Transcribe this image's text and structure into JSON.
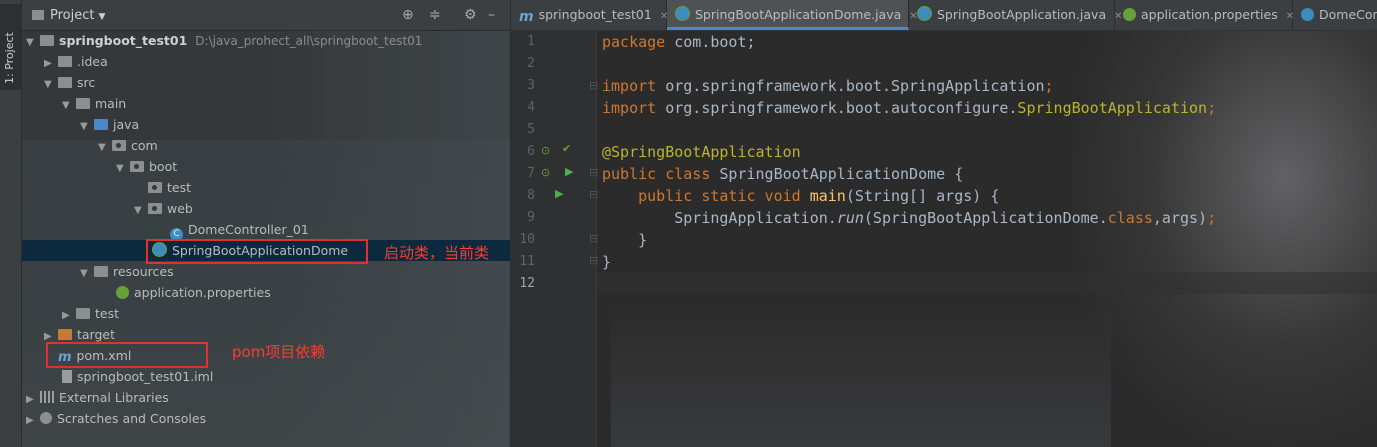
{
  "tool_strip": {
    "project_tab": "1: Project"
  },
  "project_panel": {
    "title": "Project",
    "tree": [
      {
        "label": "springboot_test01",
        "path": "D:\\java_prohect_all\\springboot_test01"
      },
      {
        "label": ".idea"
      },
      {
        "label": "src"
      },
      {
        "label": "main"
      },
      {
        "label": "java"
      },
      {
        "label": "com"
      },
      {
        "label": "boot"
      },
      {
        "label": "test"
      },
      {
        "label": "web"
      },
      {
        "label": "DomeController_01"
      },
      {
        "label": "SpringBootApplicationDome"
      },
      {
        "label": "resources"
      },
      {
        "label": "application.properties"
      },
      {
        "label": "test"
      },
      {
        "label": "target"
      },
      {
        "label": "pom.xml"
      },
      {
        "label": "springboot_test01.iml"
      },
      {
        "label": "External Libraries"
      },
      {
        "label": "Scratches and Consoles"
      }
    ],
    "annotations": {
      "startup_class": "启动类，当前类",
      "pom": "pom项目依赖"
    }
  },
  "editor": {
    "tabs": [
      {
        "label": "springboot_test01"
      },
      {
        "label": "SpringBootApplicationDome.java"
      },
      {
        "label": "SpringBootApplication.java"
      },
      {
        "label": "application.properties"
      },
      {
        "label": "DomeCon"
      }
    ],
    "active_tab": 1,
    "line_numbers": [
      "1",
      "2",
      "3",
      "4",
      "5",
      "6",
      "7",
      "8",
      "9",
      "10",
      "11",
      "12"
    ],
    "code": {
      "l1_kw": "package ",
      "l1_rest": "com.boot;",
      "l3_kw": "import ",
      "l3_rest": "org.springframework.boot.SpringApplication",
      "l3_semi": ";",
      "l4_kw": "import ",
      "l4_rest": "org.springframework.boot.autoconfigure.",
      "l4_an": "SpringBootApplication",
      "l4_semi": ";",
      "l6": "@SpringBootApplication",
      "l7_kw": "public class ",
      "l7_rest": "SpringBootApplicationDome {",
      "l8_kw": "public static void ",
      "l8_fn": "main",
      "l8_rest": "(String[] args) {",
      "l9_a": "SpringApplication.",
      "l9_run": "run",
      "l9_b": "(SpringBootApplicationDome.",
      "l9_cls": "class",
      "l9_c": ",args)",
      "l9_semi": ";",
      "l10": "}",
      "l11": "}"
    }
  },
  "colors": {
    "keyword": "#cc7832",
    "annotation": "#bbb529",
    "method": "#ffc66d",
    "text": "#a9b7c6",
    "selection": "#0d293e",
    "annotation_red": "#e03030"
  }
}
